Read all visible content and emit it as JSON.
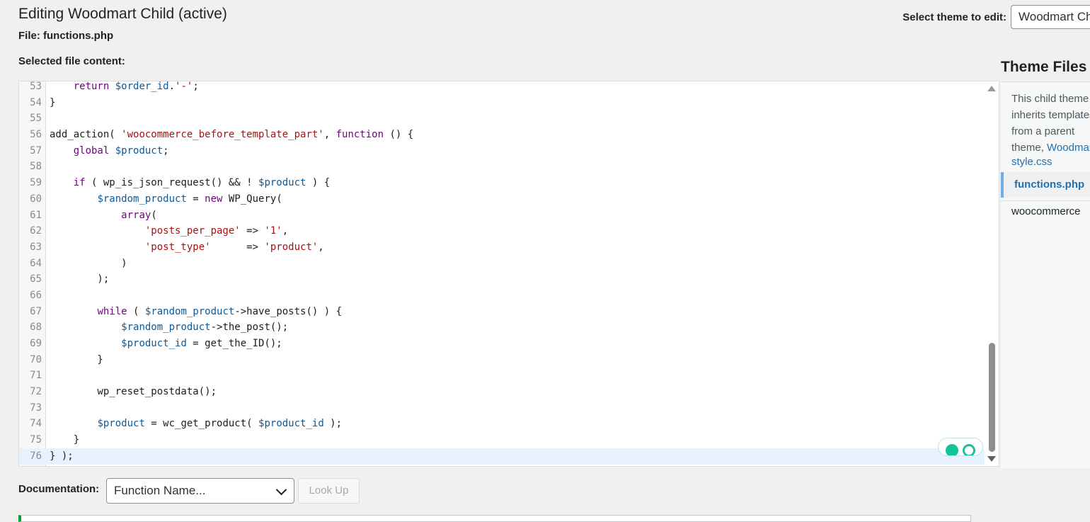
{
  "header": {
    "title": "Editing Woodmart Child (active)",
    "file_label": "File: functions.php",
    "selected_label": "Selected file content:",
    "select_theme_label": "Select theme to edit:",
    "select_theme_value": "Woodmart Child"
  },
  "editor": {
    "lines": [
      {
        "n": "53",
        "active": false,
        "tokens": [
          {
            "t": "    "
          },
          {
            "t": "return",
            "c": "k"
          },
          {
            "t": " "
          },
          {
            "t": "$order_id",
            "c": "v"
          },
          {
            "t": "."
          },
          {
            "t": "'-'",
            "c": "s"
          },
          {
            "t": ";"
          }
        ]
      },
      {
        "n": "54",
        "active": false,
        "tokens": [
          {
            "t": "}"
          }
        ]
      },
      {
        "n": "55",
        "active": false,
        "tokens": []
      },
      {
        "n": "56",
        "active": false,
        "tokens": [
          {
            "t": "add_action( "
          },
          {
            "t": "'woocommerce_before_template_part'",
            "c": "s"
          },
          {
            "t": ", "
          },
          {
            "t": "function",
            "c": "k"
          },
          {
            "t": " () {"
          }
        ]
      },
      {
        "n": "57",
        "active": false,
        "tokens": [
          {
            "t": "    "
          },
          {
            "t": "global",
            "c": "k"
          },
          {
            "t": " "
          },
          {
            "t": "$product",
            "c": "v"
          },
          {
            "t": ";"
          }
        ]
      },
      {
        "n": "58",
        "active": false,
        "tokens": []
      },
      {
        "n": "59",
        "active": false,
        "tokens": [
          {
            "t": "    "
          },
          {
            "t": "if",
            "c": "k"
          },
          {
            "t": " ( wp_is_json_request() && ! "
          },
          {
            "t": "$product",
            "c": "v"
          },
          {
            "t": " ) {"
          }
        ]
      },
      {
        "n": "60",
        "active": false,
        "tokens": [
          {
            "t": "        "
          },
          {
            "t": "$random_product",
            "c": "v"
          },
          {
            "t": " = "
          },
          {
            "t": "new",
            "c": "k"
          },
          {
            "t": " WP_Query("
          }
        ]
      },
      {
        "n": "61",
        "active": false,
        "tokens": [
          {
            "t": "            "
          },
          {
            "t": "array",
            "c": "k"
          },
          {
            "t": "("
          }
        ]
      },
      {
        "n": "62",
        "active": false,
        "tokens": [
          {
            "t": "                "
          },
          {
            "t": "'posts_per_page'",
            "c": "s"
          },
          {
            "t": " => "
          },
          {
            "t": "'1'",
            "c": "s"
          },
          {
            "t": ","
          }
        ]
      },
      {
        "n": "63",
        "active": false,
        "tokens": [
          {
            "t": "                "
          },
          {
            "t": "'post_type'",
            "c": "s"
          },
          {
            "t": "      => "
          },
          {
            "t": "'product'",
            "c": "s"
          },
          {
            "t": ","
          }
        ]
      },
      {
        "n": "64",
        "active": false,
        "tokens": [
          {
            "t": "            )"
          }
        ]
      },
      {
        "n": "65",
        "active": false,
        "tokens": [
          {
            "t": "        );"
          }
        ]
      },
      {
        "n": "66",
        "active": false,
        "tokens": []
      },
      {
        "n": "67",
        "active": false,
        "tokens": [
          {
            "t": "        "
          },
          {
            "t": "while",
            "c": "k"
          },
          {
            "t": " ( "
          },
          {
            "t": "$random_product",
            "c": "v"
          },
          {
            "t": "->have_posts() ) {"
          }
        ]
      },
      {
        "n": "68",
        "active": false,
        "tokens": [
          {
            "t": "            "
          },
          {
            "t": "$random_product",
            "c": "v"
          },
          {
            "t": "->the_post();"
          }
        ]
      },
      {
        "n": "69",
        "active": false,
        "tokens": [
          {
            "t": "            "
          },
          {
            "t": "$product_id",
            "c": "v"
          },
          {
            "t": " = get_the_ID();"
          }
        ]
      },
      {
        "n": "70",
        "active": false,
        "tokens": [
          {
            "t": "        }"
          }
        ]
      },
      {
        "n": "71",
        "active": false,
        "tokens": []
      },
      {
        "n": "72",
        "active": false,
        "tokens": [
          {
            "t": "        wp_reset_postdata();"
          }
        ]
      },
      {
        "n": "73",
        "active": false,
        "tokens": []
      },
      {
        "n": "74",
        "active": false,
        "tokens": [
          {
            "t": "        "
          },
          {
            "t": "$product",
            "c": "v"
          },
          {
            "t": " = wc_get_product( "
          },
          {
            "t": "$product_id",
            "c": "v"
          },
          {
            "t": " );"
          }
        ]
      },
      {
        "n": "75",
        "active": false,
        "tokens": [
          {
            "t": "    }"
          }
        ]
      },
      {
        "n": "76",
        "active": true,
        "tokens": [
          {
            "t": "} );"
          }
        ]
      }
    ]
  },
  "sidebar": {
    "heading": "Theme Files",
    "description": "This child theme inherits templates from a parent theme,",
    "parent_link": "Woodmart.",
    "files": [
      {
        "label": "style.css",
        "active": false
      },
      {
        "label": "functions.php",
        "active": true
      },
      {
        "label": "woocommerce",
        "active": false
      }
    ]
  },
  "documentation": {
    "label": "Documentation:",
    "select_value": "Function Name...",
    "lookup_button": "Look Up"
  },
  "colors": {
    "keyword": "#770088",
    "variable": "#0a5a9c",
    "string": "#aa1111",
    "link": "#2271b1",
    "active_line": "#e8f2fe",
    "notice_border": "#00a32a"
  }
}
